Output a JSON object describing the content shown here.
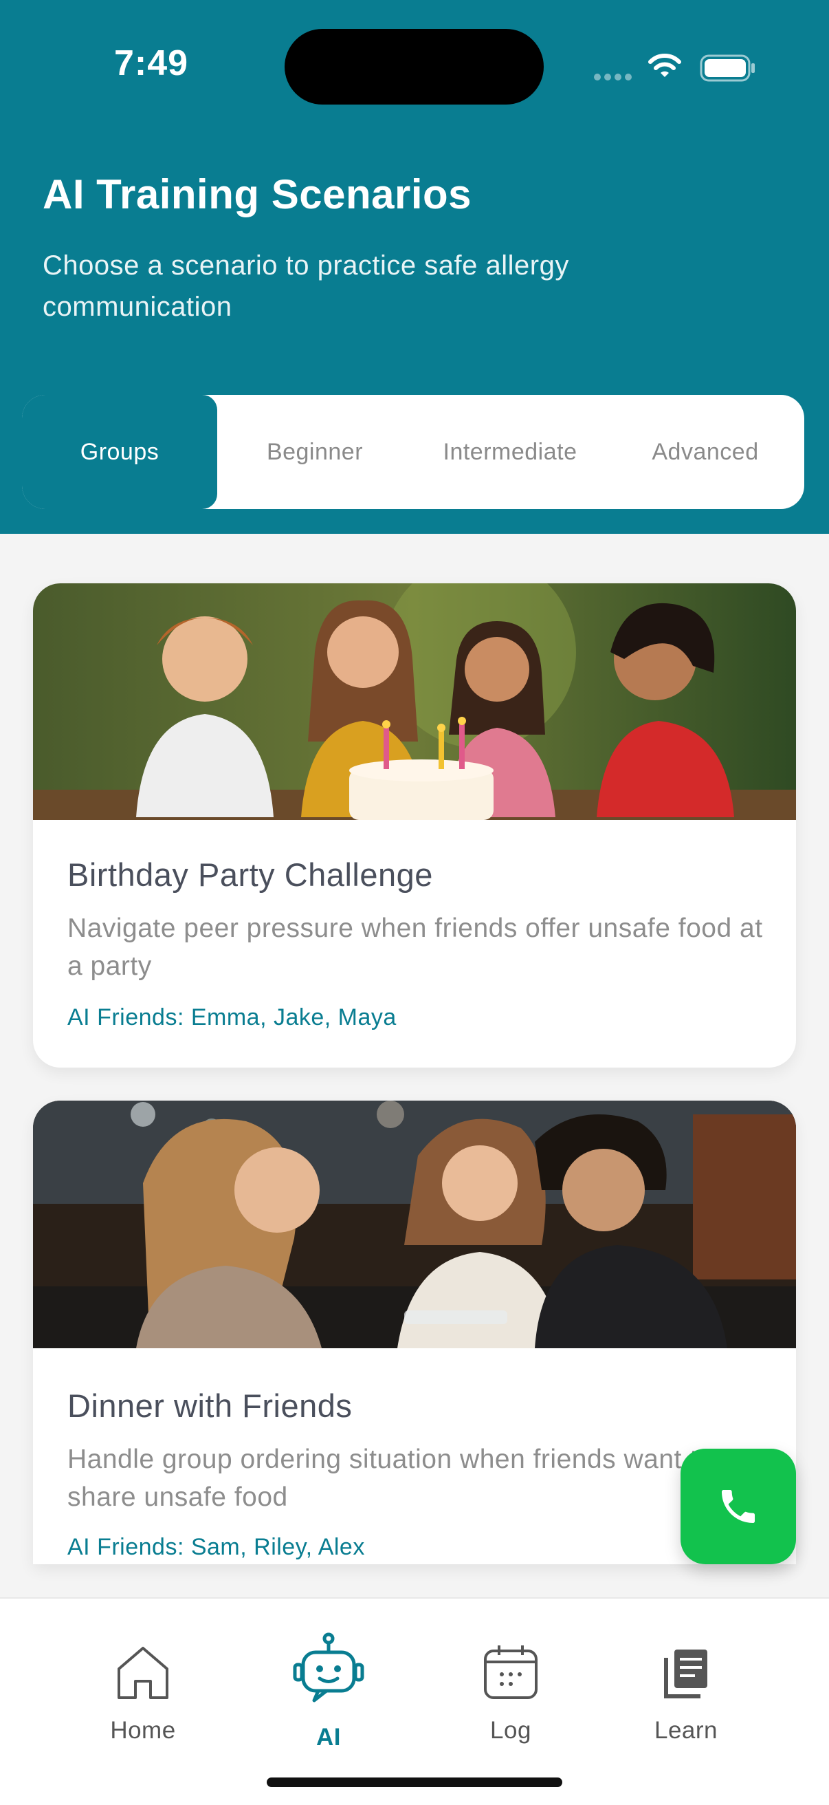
{
  "status_bar": {
    "time": "7:49"
  },
  "header": {
    "title": "AI Training Scenarios",
    "subtitle": "Choose a scenario to practice safe allergy communication"
  },
  "tabs": [
    {
      "label": "Groups",
      "active": true
    },
    {
      "label": "Beginner",
      "active": false
    },
    {
      "label": "Intermediate",
      "active": false
    },
    {
      "label": "Advanced",
      "active": false
    }
  ],
  "scenarios": [
    {
      "title": "Birthday Party Challenge",
      "description": "Navigate peer pressure when friends offer unsafe food at a party",
      "friends": "AI Friends: Emma, Jake, Maya",
      "image": "kids-birthday-party-photo"
    },
    {
      "title": "Dinner with Friends",
      "description": "Handle group ordering situation when friends want to share unsafe food",
      "friends": "AI Friends: Sam, Riley, Alex",
      "image": "kids-dinner-phone-photo"
    }
  ],
  "fab": {
    "icon": "phone-icon"
  },
  "nav": [
    {
      "label": "Home",
      "icon": "home-icon",
      "active": false
    },
    {
      "label": "AI",
      "icon": "robot-icon",
      "active": true
    },
    {
      "label": "Log",
      "icon": "calendar-icon",
      "active": false
    },
    {
      "label": "Learn",
      "icon": "book-stack-icon",
      "active": false
    }
  ],
  "colors": {
    "primary": "#097d91",
    "call": "#12c24d",
    "background": "#f4f4f4"
  }
}
